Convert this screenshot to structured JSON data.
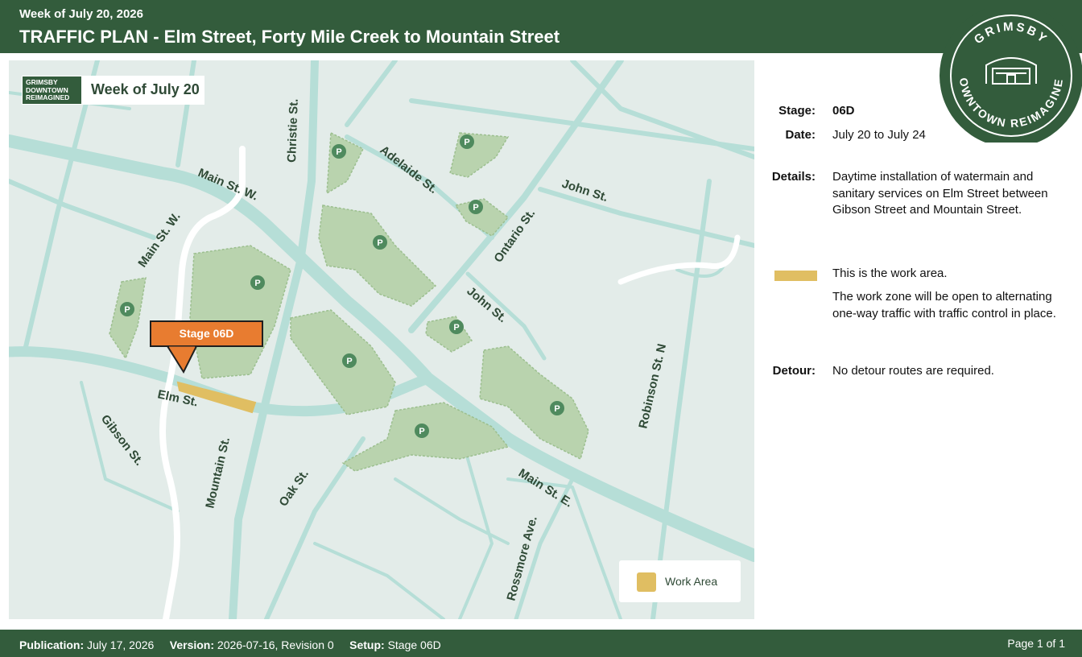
{
  "header": {
    "subtitle": "Week of July 20, 2026",
    "title": "TRAFFIC PLAN - Elm Street, Forty Mile Creek to Mountain Street"
  },
  "logo": {
    "top_text": "GRIMSBY",
    "bottom_text": "DOWNTOWN REIMAGINED"
  },
  "map": {
    "badge_logo_text": "GRIMSBY DOWNTOWN REIMAGINED",
    "badge_week": "Week of July 20",
    "callout": "Stage 06D",
    "legend_label": "Work Area",
    "streets": {
      "christie": "Christie St.",
      "main_w_top": "Main St. W.",
      "main_w_left": "Main St. W.",
      "adelaide": "Adelaide St.",
      "john_top": "John St.",
      "ontario": "Ontario St.",
      "john_mid": "John St.",
      "elm": "Elm St.",
      "gibson": "Gibson St.",
      "mountain": "Mountain St.",
      "oak": "Oak St.",
      "main_e": "Main St. E.",
      "rossmore": "Rossmore Ave.",
      "robinson": "Robinson St. N"
    },
    "colors": {
      "background": "#e3ece9",
      "road": "#b6ded7",
      "parking": "#b9d3ae",
      "work_area": "#e0be62",
      "callout": "#e87c30"
    }
  },
  "details": {
    "stage_label": "Stage:",
    "stage_value": "06D",
    "date_label": "Date:",
    "date_value": "July 20 to July 24",
    "details_label": "Details:",
    "details_value": "Daytime installation of watermain and sanitary services on Elm Street between Gibson Street and Mountain Street.",
    "legend_text": "This is the work area.",
    "legend_note": "The work zone will be open to alternating one-way traffic with traffic control in place.",
    "detour_label": "Detour:",
    "detour_value": "No detour routes are required."
  },
  "footer": {
    "publication_label": "Publication:",
    "publication_value": "July 17, 2026",
    "version_label": "Version:",
    "version_value": "2026-07-16, Revision 0",
    "setup_label": "Setup:",
    "setup_value": "Stage 06D",
    "page": "Page 1 of 1"
  }
}
